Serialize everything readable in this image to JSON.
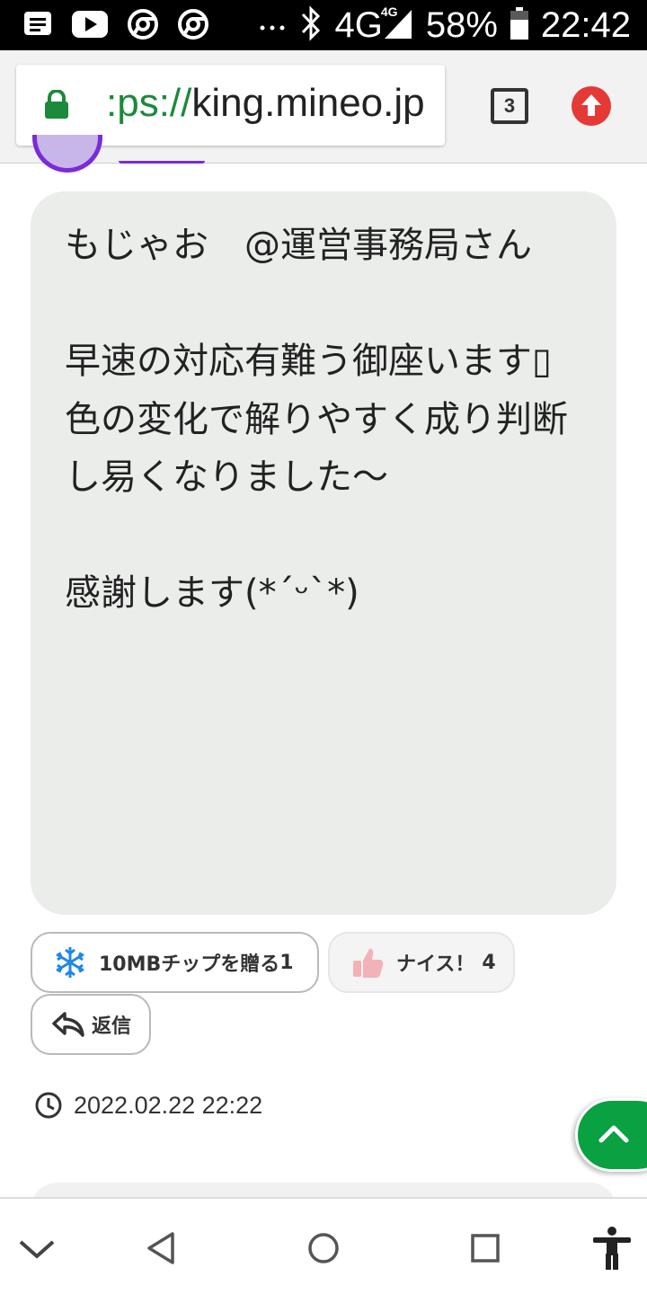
{
  "status_bar": {
    "network": "4G",
    "network_small": "4G",
    "battery": "58%",
    "time": "22:42"
  },
  "browser": {
    "url_scheme": ":ps://",
    "url_host": "king.mineo.jp",
    "tab_count": "3"
  },
  "post": {
    "body": "もじゃお　@運営事務局さん\n\n早速の対応有難う御座います▯\n色の変化で解りやすく成り判断し易くなりました〜\n\n感謝します(*´ᵕ`*)"
  },
  "actions": {
    "tip_label": "10MBチップを贈る",
    "tip_count": "1",
    "nice_label": "ナイス！",
    "nice_count": "4",
    "reply_label": "返信"
  },
  "timestamp": "2022.02.22 22:22",
  "icons": {
    "status_left": [
      "message-icon",
      "youtube-icon",
      "chrome-icon",
      "chrome-icon",
      "more-icon"
    ],
    "status_right": [
      "bluetooth-icon",
      "signal-icon",
      "battery-icon"
    ],
    "nav": [
      "down-chevron-icon",
      "back-icon",
      "home-icon",
      "recents-icon",
      "accessibility-icon"
    ]
  },
  "colors": {
    "accent_green": "#0aa142",
    "url_green": "#1b8a3a",
    "avatar_purple": "#7b2bd9",
    "upload_red": "#e53935",
    "bubble_bg": "#eaedea"
  }
}
